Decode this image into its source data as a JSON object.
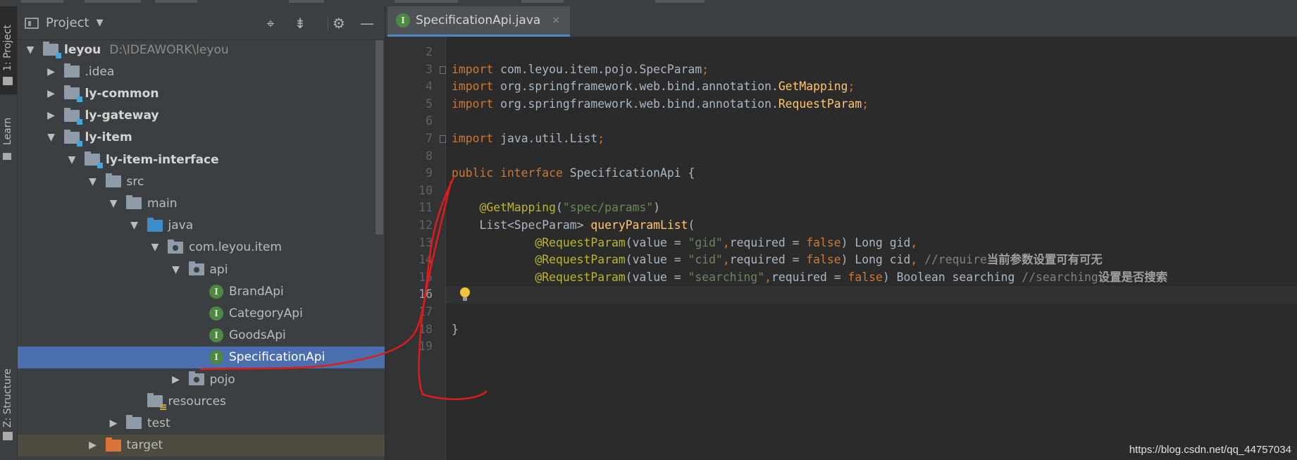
{
  "side_tabs": {
    "project": "1: Project",
    "learn": "Learn",
    "structure": "Z: Structure"
  },
  "project_panel": {
    "title": "Project",
    "header_icons": [
      "crosshair-icon",
      "collapse-all-icon",
      "gear-icon",
      "minimize-icon"
    ],
    "tree": [
      {
        "label": "leyou",
        "path": "D:\\IDEAWORK\\leyou",
        "depth": 0,
        "arrow": "expanded",
        "icon": "module-folder",
        "bold": true
      },
      {
        "label": ".idea",
        "depth": 1,
        "arrow": "collapsed",
        "icon": "folder"
      },
      {
        "label": "ly-common",
        "depth": 1,
        "arrow": "collapsed",
        "icon": "module-folder",
        "bold": true
      },
      {
        "label": "ly-gateway",
        "depth": 1,
        "arrow": "collapsed",
        "icon": "module-folder",
        "bold": true
      },
      {
        "label": "ly-item",
        "depth": 1,
        "arrow": "expanded",
        "icon": "module-folder",
        "bold": true
      },
      {
        "label": "ly-item-interface",
        "depth": 2,
        "arrow": "expanded",
        "icon": "module-folder",
        "bold": true
      },
      {
        "label": "src",
        "depth": 3,
        "arrow": "expanded",
        "icon": "folder"
      },
      {
        "label": "main",
        "depth": 4,
        "arrow": "expanded",
        "icon": "folder"
      },
      {
        "label": "java",
        "depth": 5,
        "arrow": "expanded",
        "icon": "source-folder"
      },
      {
        "label": "com.leyou.item",
        "depth": 6,
        "arrow": "expanded",
        "icon": "package"
      },
      {
        "label": "api",
        "depth": 7,
        "arrow": "expanded",
        "icon": "package"
      },
      {
        "label": "BrandApi",
        "depth": 8,
        "arrow": "none",
        "icon": "interface"
      },
      {
        "label": "CategoryApi",
        "depth": 8,
        "arrow": "none",
        "icon": "interface"
      },
      {
        "label": "GoodsApi",
        "depth": 8,
        "arrow": "none",
        "icon": "interface"
      },
      {
        "label": "SpecificationApi",
        "depth": 8,
        "arrow": "none",
        "icon": "interface",
        "selected": true
      },
      {
        "label": "pojo",
        "depth": 7,
        "arrow": "collapsed",
        "icon": "package"
      },
      {
        "label": "resources",
        "depth": 5,
        "arrow": "none",
        "icon": "resources-folder"
      },
      {
        "label": "test",
        "depth": 4,
        "arrow": "collapsed",
        "icon": "folder"
      },
      {
        "label": "target",
        "depth": 3,
        "arrow": "collapsed",
        "icon": "excluded-folder",
        "highlight": true
      }
    ]
  },
  "editor": {
    "tab": {
      "label": "SpecificationApi.java",
      "icon": "interface",
      "close": "×"
    },
    "current_line": 16,
    "lines": [
      {
        "n": "2",
        "t": []
      },
      {
        "n": "3",
        "t": [
          [
            "kw",
            "import"
          ],
          [
            "",
            "com.leyou.item.pojo.SpecParam"
          ],
          [
            "kw",
            ";"
          ]
        ]
      },
      {
        "n": "4",
        "t": [
          [
            "kw",
            "import"
          ],
          [
            "",
            "org.springframework.web.bind.annotation."
          ],
          [
            "cn",
            "GetMapping"
          ],
          [
            "kw",
            ";"
          ]
        ]
      },
      {
        "n": "5",
        "t": [
          [
            "kw",
            "import"
          ],
          [
            "",
            "org.springframework.web.bind.annotation."
          ],
          [
            "cn",
            "RequestParam"
          ],
          [
            "kw",
            ";"
          ]
        ]
      },
      {
        "n": "6",
        "t": []
      },
      {
        "n": "7",
        "t": [
          [
            "kw",
            "import"
          ],
          [
            "",
            "java.util.List"
          ],
          [
            "kw",
            ";"
          ]
        ]
      },
      {
        "n": "8",
        "t": []
      },
      {
        "n": "9",
        "t": [
          [
            "kw",
            "public interface"
          ],
          [
            "",
            "SpecificationApi {"
          ]
        ]
      },
      {
        "n": "10",
        "t": []
      },
      {
        "n": "11",
        "t": [
          [
            "",
            "    "
          ],
          [
            "ann",
            "@GetMapping"
          ],
          [
            "",
            "("
          ],
          [
            "str",
            "\"spec/params\""
          ],
          [
            "",
            ")"
          ]
        ]
      },
      {
        "n": "12",
        "t": [
          [
            "",
            "    List<SpecParam> "
          ],
          [
            "cn",
            "queryParamList"
          ],
          [
            "",
            "("
          ]
        ]
      },
      {
        "n": "13",
        "t": [
          [
            "",
            "            "
          ],
          [
            "ann",
            "@RequestParam"
          ],
          [
            "",
            "(value = "
          ],
          [
            "str",
            "\"gid\""
          ],
          [
            "kw",
            ","
          ],
          [
            "",
            "required = "
          ],
          [
            "kw",
            "false"
          ],
          [
            "",
            ") Long gid"
          ],
          [
            "kw",
            ","
          ]
        ]
      },
      {
        "n": "14",
        "t": [
          [
            "",
            "            "
          ],
          [
            "ann",
            "@RequestParam"
          ],
          [
            "",
            "(value = "
          ],
          [
            "str",
            "\"cid\""
          ],
          [
            "kw",
            ","
          ],
          [
            "",
            "required = "
          ],
          [
            "kw",
            "false"
          ],
          [
            "",
            ") Long cid"
          ],
          [
            "kw",
            ","
          ],
          [
            "",
            " "
          ],
          [
            "cmt",
            "//require"
          ],
          [
            "cmt-b",
            "当前参数设置可有可无"
          ]
        ]
      },
      {
        "n": "15",
        "t": [
          [
            "",
            "            "
          ],
          [
            "ann",
            "@RequestParam"
          ],
          [
            "",
            "(value = "
          ],
          [
            "str",
            "\"searching\""
          ],
          [
            "kw",
            ","
          ],
          [
            "",
            "required = "
          ],
          [
            "kw",
            "false"
          ],
          [
            "",
            ") Boolean searching "
          ],
          [
            "cmt",
            "//searching"
          ],
          [
            "cmt-b",
            "设置是否搜索"
          ]
        ]
      },
      {
        "n": "16",
        "t": [
          [
            "",
            "    );"
          ]
        ]
      },
      {
        "n": "17",
        "t": []
      },
      {
        "n": "18",
        "t": [
          [
            "",
            "}"
          ]
        ]
      },
      {
        "n": "19",
        "t": []
      }
    ]
  },
  "watermark": "https://blog.csdn.net/qq_44757034"
}
